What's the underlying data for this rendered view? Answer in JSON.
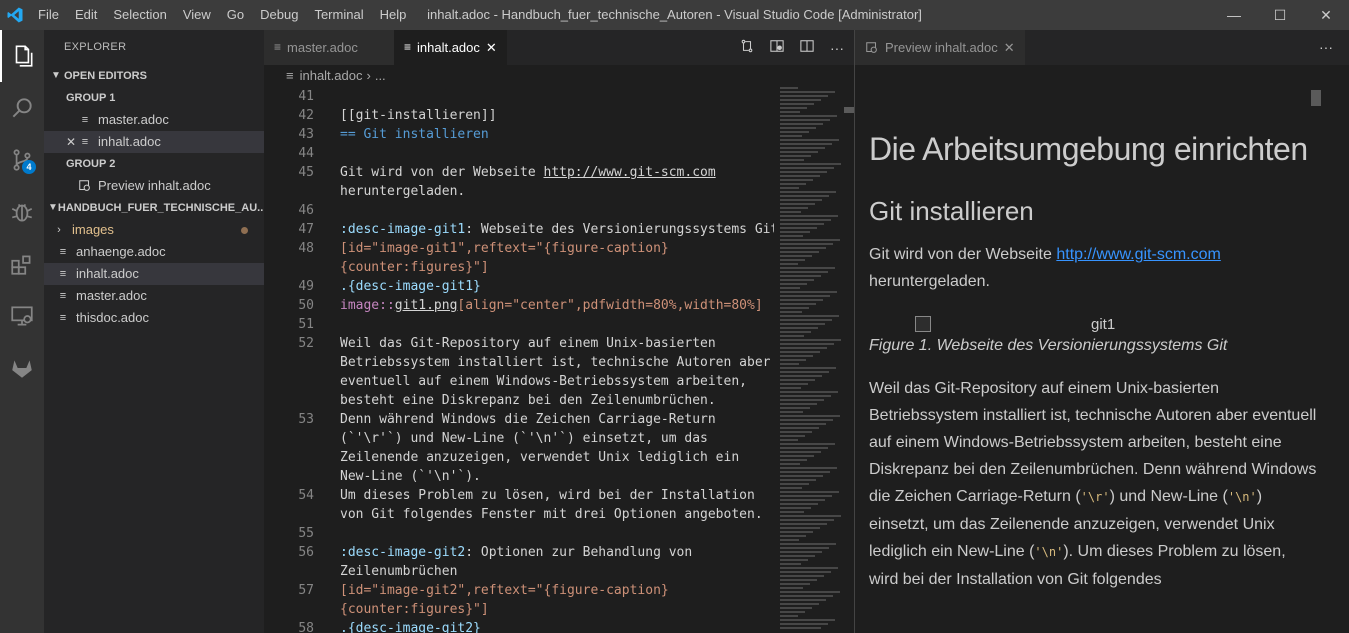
{
  "titlebar": {
    "menu": [
      "File",
      "Edit",
      "Selection",
      "View",
      "Go",
      "Debug",
      "Terminal",
      "Help"
    ],
    "title": "inhalt.adoc - Handbuch_fuer_technische_Autoren - Visual Studio Code [Administrator]",
    "controls": {
      "minimize": "—",
      "maximize": "☐",
      "close": "✕"
    }
  },
  "activitybar": {
    "items": [
      "explorer-icon",
      "search-icon",
      "source-control-icon",
      "debug-icon",
      "extensions-icon",
      "remote-explorer-icon",
      "gitlab-icon"
    ],
    "scm_badge": "4"
  },
  "sidebar": {
    "title": "EXPLORER",
    "open_editors_label": "OPEN EDITORS",
    "group1_label": "GROUP 1",
    "group1_items": [
      "master.adoc",
      "inhalt.adoc"
    ],
    "group2_label": "GROUP 2",
    "group2_items": [
      "Preview inhalt.adoc"
    ],
    "project_label": "HANDBUCH_FUER_TECHNISCHE_AU...",
    "files": [
      "images",
      "anhaenge.adoc",
      "inhalt.adoc",
      "master.adoc",
      "thisdoc.adoc"
    ]
  },
  "editor": {
    "tabs": [
      {
        "label": "master.adoc"
      },
      {
        "label": "inhalt.adoc",
        "close": "✕"
      }
    ],
    "breadcrumb": {
      "file": "inhalt.adoc",
      "sep": "›",
      "more": "..."
    },
    "lines": [
      {
        "n": "41",
        "t": ""
      },
      {
        "n": "42",
        "t": "[[git-installieren]]"
      },
      {
        "n": "43",
        "t": "== Git installieren"
      },
      {
        "n": "44",
        "t": ""
      },
      {
        "n": "45",
        "t": "Git wird von der Webseite ",
        "link": "http://www.git-scm.com"
      },
      {
        "n": "",
        "t": "heruntergeladen."
      },
      {
        "n": "46",
        "t": ""
      },
      {
        "n": "47",
        "attr": ":desc-image-git1",
        "t": ": Webseite des Versionierungssystems Git"
      },
      {
        "n": "48",
        "t": "[id=\"image-git1\",reftext=\"{figure-caption}"
      },
      {
        "n": "",
        "t": "{counter:figures}\"]"
      },
      {
        "n": "49",
        "t": ".{desc-image-git1}"
      },
      {
        "n": "50",
        "kw": "image::",
        "t": "git1.png[align=\"center\",pdfwidth=80%,width=80%]"
      },
      {
        "n": "51",
        "t": ""
      },
      {
        "n": "52",
        "t": "Weil das Git-Repository auf einem Unix-basierten"
      },
      {
        "n": "",
        "t": "Betriebssystem installiert ist, technische Autoren aber"
      },
      {
        "n": "",
        "t": "eventuell auf einem Windows-Betriebssystem arbeiten,"
      },
      {
        "n": "",
        "t": "besteht eine Diskrepanz bei den Zeilenumbrüchen."
      },
      {
        "n": "53",
        "t": "Denn während Windows die Zeichen Carriage-Return"
      },
      {
        "n": "",
        "t": "(`'\\r'`) und New-Line (`'\\n'`) einsetzt, um das"
      },
      {
        "n": "",
        "t": "Zeilenende anzuzeigen, verwendet Unix lediglich ein"
      },
      {
        "n": "",
        "t": "New-Line (`'\\n'`)."
      },
      {
        "n": "54",
        "t": "Um dieses Problem zu lösen, wird bei der Installation"
      },
      {
        "n": "",
        "t": "von Git folgendes Fenster mit drei Optionen angeboten."
      },
      {
        "n": "55",
        "t": ""
      },
      {
        "n": "56",
        "attr": ":desc-image-git2",
        "t": ": Optionen zur Behandlung von"
      },
      {
        "n": "",
        "t": "Zeilenumbrüchen"
      },
      {
        "n": "57",
        "t": "[id=\"image-git2\",reftext=\"{figure-caption}"
      },
      {
        "n": "",
        "t": "{counter:figures}\"]"
      },
      {
        "n": "58",
        "t": ".{desc-image-git2}"
      }
    ]
  },
  "preview": {
    "tab_label": "Preview inhalt.adoc",
    "tab_close": "✕",
    "more": "···",
    "h1": "Die Arbeitsumgebung einrichten",
    "h2": "Git installieren",
    "p1_text": "Git wird von der Webseite ",
    "p1_link": "http://www.git-scm.com",
    "p1_end": " heruntergeladen.",
    "img_alt": "git1",
    "caption": "Figure 1. Webseite des Versionierungssystems Git",
    "p2_a": "Weil das Git-Repository auf einem Unix-basierten Betriebssystem installiert ist, technische Autoren aber eventuell auf einem Windows-Betriebssystem arbeiten, besteht eine Diskrepanz bei den Zeilenumbrüchen. Denn während Windows die Zeichen Carriage-Return (",
    "code_r": "'\\r'",
    "p2_b": ") und New-Line (",
    "code_n": "'\\n'",
    "p2_c": ") einsetzt, um das Zeilenende anzuzeigen, verwendet Unix lediglich ein New-Line (",
    "code_n2": "'\\n'",
    "p2_d": "). Um dieses Problem zu lösen, wird bei der Installation von Git folgendes"
  },
  "colors": {
    "accent": "#007acc",
    "titlebar_bg": "#3c3c3c",
    "activitybar_bg": "#333333",
    "sidebar_bg": "#252526",
    "editor_bg": "#1e1e1e",
    "link": "#3794ff"
  }
}
